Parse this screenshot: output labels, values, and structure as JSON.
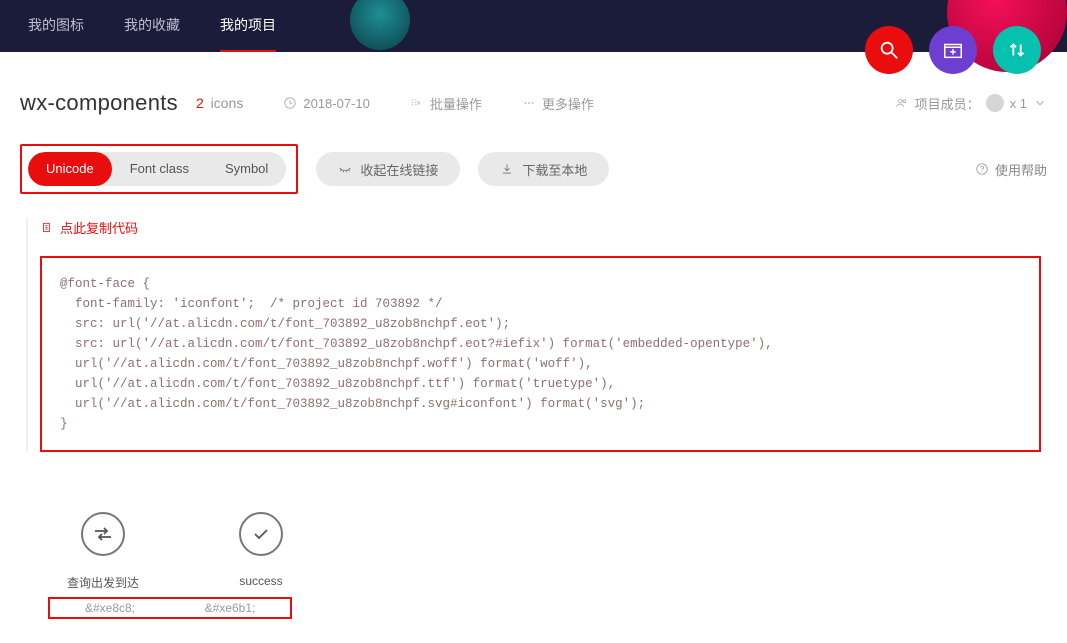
{
  "tabs": {
    "mine_icons": "我的图标",
    "mine_favs": "我的收藏",
    "mine_projects": "我的项目",
    "active": "mine_projects"
  },
  "project": {
    "name": "wx-components",
    "icon_count": "2",
    "icon_unit": "icons",
    "date": "2018-07-10",
    "batch": "批量操作",
    "more": "更多操作"
  },
  "members": {
    "label": "项目成员：",
    "count": "x 1"
  },
  "modes": {
    "unicode": "Unicode",
    "fontclass": "Font class",
    "symbol": "Symbol"
  },
  "actions": {
    "collapse_link": "收起在线链接",
    "download_local": "下载至本地",
    "help": "使用帮助"
  },
  "code": {
    "copy_label": "点此复制代码",
    "body": "@font-face {\n  font-family: 'iconfont';  /* project id 703892 */\n  src: url('//at.alicdn.com/t/font_703892_u8zob8nchpf.eot');\n  src: url('//at.alicdn.com/t/font_703892_u8zob8nchpf.eot?#iefix') format('embedded-opentype'),\n  url('//at.alicdn.com/t/font_703892_u8zob8nchpf.woff') format('woff'),\n  url('//at.alicdn.com/t/font_703892_u8zob8nchpf.ttf') format('truetype'),\n  url('//at.alicdn.com/t/font_703892_u8zob8nchpf.svg#iconfont') format('svg');\n}"
  },
  "icons": [
    {
      "name": "查询出发到达",
      "code": "&#xe8c8;",
      "shape": "swap"
    },
    {
      "name": "success",
      "code": "&#xe6b1;",
      "shape": "check"
    }
  ]
}
